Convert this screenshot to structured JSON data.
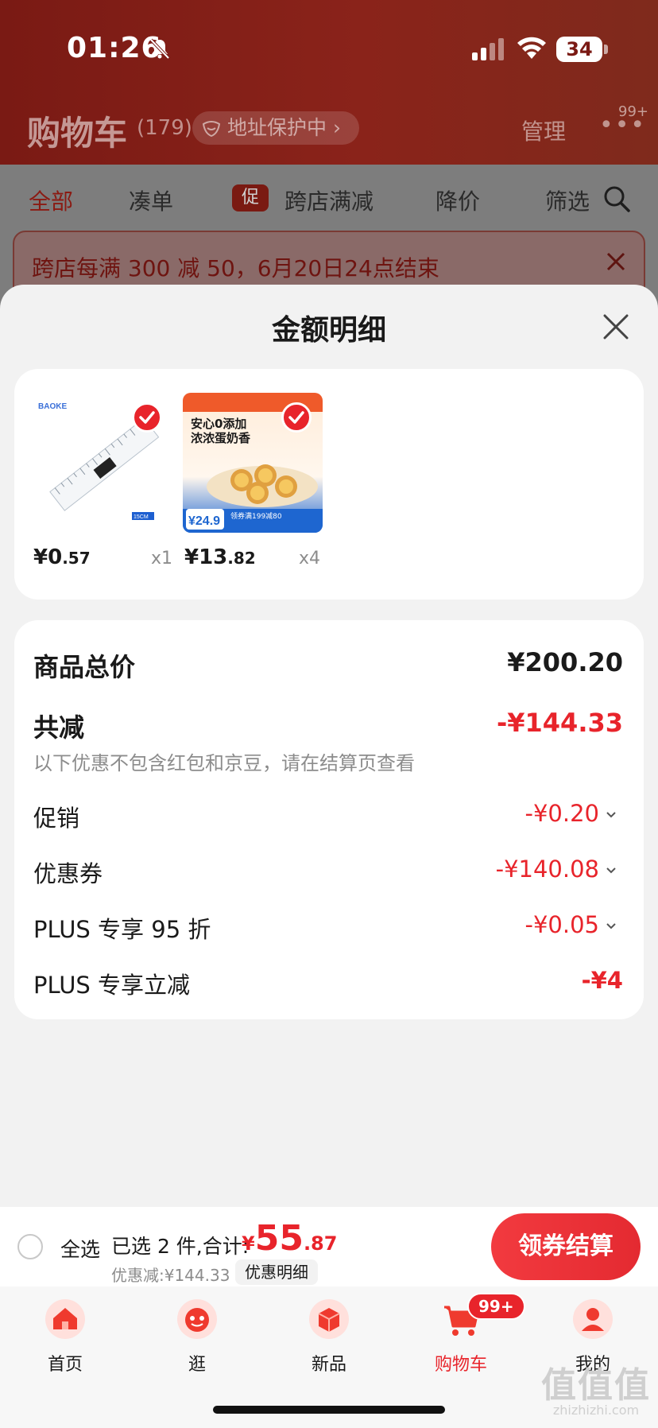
{
  "status_bar": {
    "time": "01:26",
    "battery": "34"
  },
  "background": {
    "title": "购物车",
    "count": "(179)",
    "address_pill": "地址保护中 ›",
    "manage": "管理",
    "more_badge": "99+",
    "tabs": [
      "全部",
      "凑单",
      "跨店满减",
      "降价",
      "筛选"
    ],
    "promo_badge": "促",
    "notice": "跨店每满 300 减 50，6月20日24点结束"
  },
  "sheet": {
    "title": "金额明细",
    "products": [
      {
        "price_int": "¥0",
        "price_dec": ".57",
        "qty": "x1",
        "icon": "ruler-product-image",
        "img_brand": "BAOKE",
        "img_tag": "15CM"
      },
      {
        "price_int": "¥13",
        "price_dec": ".82",
        "qty": "x4",
        "icon": "egg-tart-product-image",
        "img_title": "安心0添加",
        "img_title2": "浓浓蛋奶香",
        "img_price": "¥24.9",
        "img_promo": "领券满199减80"
      }
    ],
    "total_label": "商品总价",
    "total_value": "¥200.20",
    "reduce_label": "共减",
    "reduce_value": "-¥144.33",
    "note": "以下优惠不包含红包和京豆，请在结算页查看",
    "rows": [
      {
        "label": "促销",
        "value": "-¥0.20"
      },
      {
        "label": "优惠券",
        "value": "-¥140.08"
      },
      {
        "label": "PLUS 专享 95 折",
        "value": "-¥0.05"
      },
      {
        "label": "PLUS 专享立减",
        "value": "-¥4"
      }
    ]
  },
  "checkout": {
    "select_all": "全选",
    "selected_info": "已选 2 件,合计:",
    "total_cur": "¥",
    "total_int": "55",
    "total_dec": ".87",
    "discount": "优惠减:¥144.33",
    "detail_link": "优惠明细",
    "button": "领券结算"
  },
  "tabbar": {
    "items": [
      {
        "label": "首页",
        "icon": "home-icon"
      },
      {
        "label": "逛",
        "icon": "browse-icon"
      },
      {
        "label": "新品",
        "icon": "new-products-icon"
      },
      {
        "label": "购物车",
        "icon": "cart-icon"
      },
      {
        "label": "我的",
        "icon": "profile-icon"
      }
    ],
    "cart_badge": "99+"
  },
  "watermark": {
    "big": "值值值",
    "small": "zhizhizhi.com"
  },
  "colors": {
    "accent": "#e8242b",
    "header_dim": "#7a1a14"
  }
}
